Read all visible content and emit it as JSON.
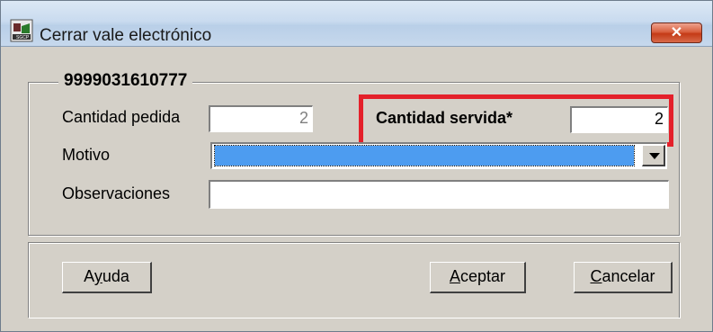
{
  "window": {
    "title": "Cerrar vale electrónico",
    "close_label": "✕"
  },
  "group": {
    "title": "9999031610777"
  },
  "form": {
    "cantidad_pedida": {
      "label": "Cantidad pedida",
      "value": "2"
    },
    "cantidad_servida": {
      "label": "Cantidad servida*",
      "value": "2"
    },
    "motivo": {
      "label": "Motivo",
      "selected": ""
    },
    "observaciones": {
      "label": "Observaciones",
      "value": ""
    }
  },
  "buttons": {
    "ayuda": {
      "before": "A",
      "accel": "y",
      "after": "uda"
    },
    "aceptar": {
      "before": "",
      "accel": "A",
      "after": "ceptar"
    },
    "cancelar": {
      "before": "",
      "accel": "C",
      "after": "ancelar"
    }
  },
  "colors": {
    "highlight": "#e4202a",
    "combo_selection": "#4d9cf0",
    "dialog_bg": "#d4d0c8"
  }
}
